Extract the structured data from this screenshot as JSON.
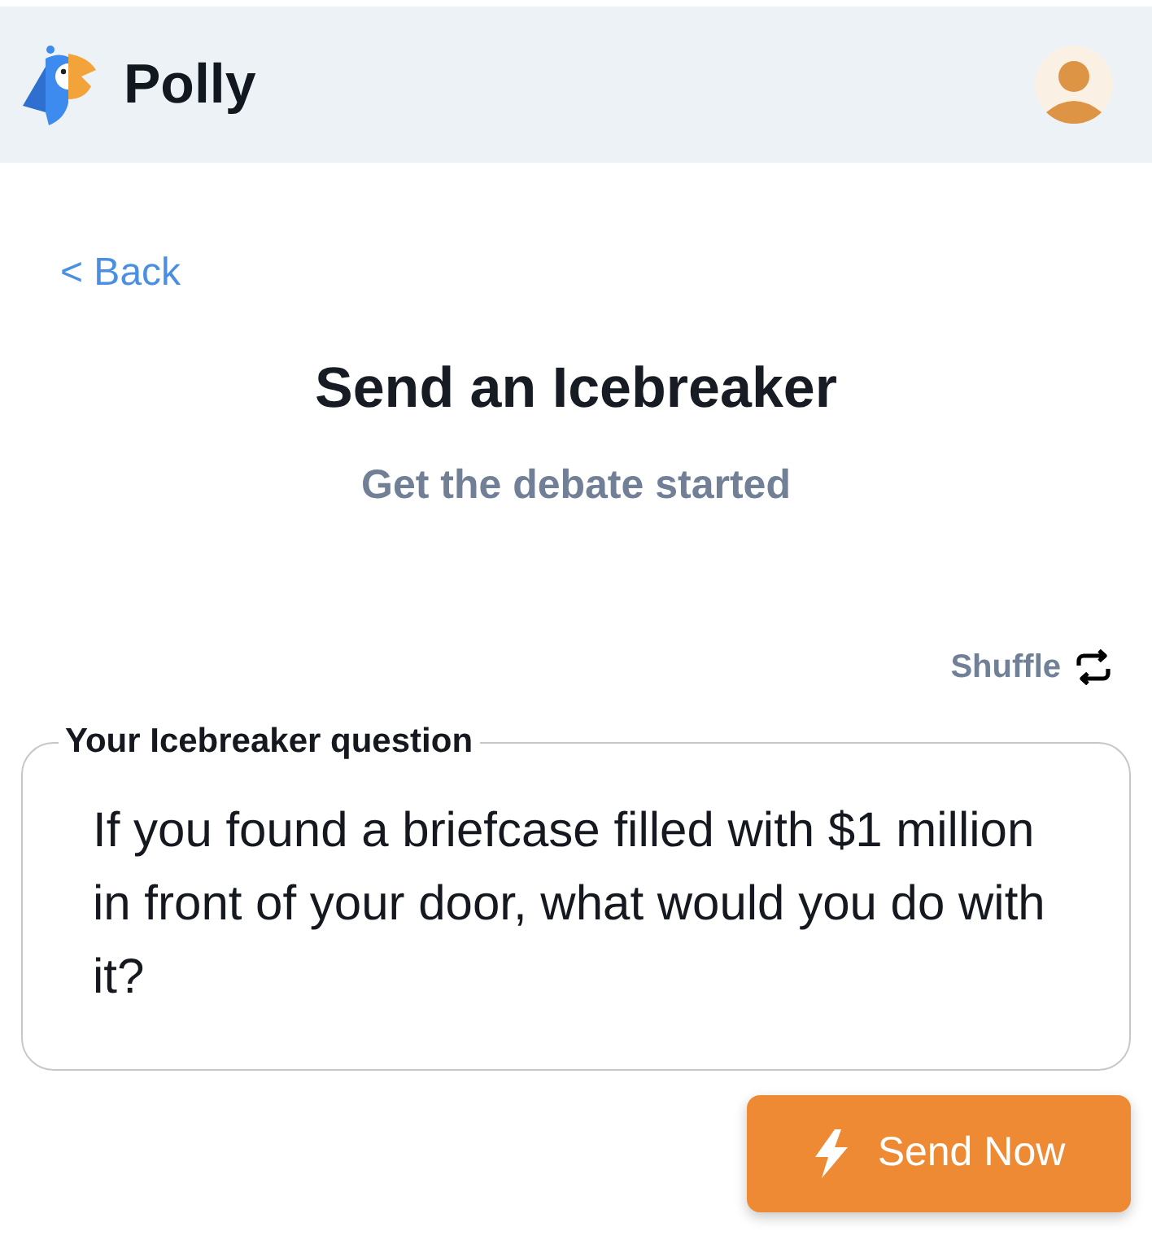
{
  "header": {
    "app_name": "Polly"
  },
  "back_link": {
    "label": "< Back"
  },
  "title": "Send an Icebreaker",
  "subtitle": "Get the debate started",
  "shuffle": {
    "label": "Shuffle"
  },
  "question": {
    "label": "Your Icebreaker question",
    "value": "If you found a briefcase filled with $1 million in front of your door, what would you do with it?"
  },
  "send_button": {
    "label": "Send Now"
  }
}
